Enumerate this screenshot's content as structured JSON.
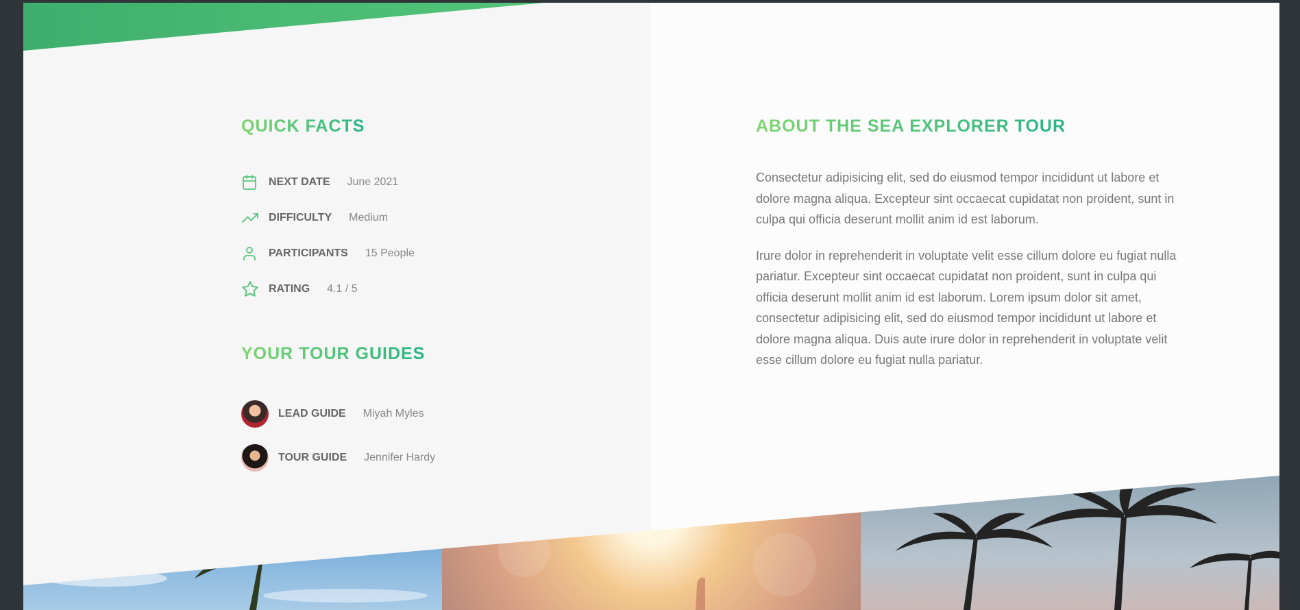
{
  "quick_facts": {
    "title": "QUICK FACTS",
    "items": [
      {
        "icon": "calendar-icon",
        "label": "NEXT DATE",
        "value": "June 2021"
      },
      {
        "icon": "trending-up-icon",
        "label": "DIFFICULTY",
        "value": "Medium"
      },
      {
        "icon": "user-icon",
        "label": "PARTICIPANTS",
        "value": "15 People"
      },
      {
        "icon": "star-icon",
        "label": "RATING",
        "value": "4.1 / 5"
      }
    ]
  },
  "tour_guides": {
    "title": "YOUR TOUR GUIDES",
    "guides": [
      {
        "role": "LEAD GUIDE",
        "name": "Miyah Myles"
      },
      {
        "role": "TOUR GUIDE",
        "name": "Jennifer Hardy"
      }
    ]
  },
  "about": {
    "title": "ABOUT THE SEA EXPLORER TOUR",
    "paragraphs": [
      "Consectetur adipisicing elit, sed do eiusmod tempor incididunt ut labore et dolore magna aliqua. Excepteur sint occaecat cupidatat non proident, sunt in culpa qui officia deserunt mollit anim id est laborum.",
      "Irure dolor in reprehenderit in voluptate velit esse cillum dolore eu fugiat nulla pariatur. Excepteur sint occaecat cupidatat non proident, sunt in culpa qui officia deserunt mollit anim id est laborum. Lorem ipsum dolor sit amet, consectetur adipisicing elit, sed do eiusmod tempor incididunt ut labore et dolore magna aliqua. Duis aute irure dolor in reprehenderit in voluptate velit esse cillum dolore eu fugiat nulla pariatur."
    ]
  },
  "colors": {
    "accent_start": "#7ed56f",
    "accent_end": "#28b485",
    "icon_green": "#55c57a"
  }
}
